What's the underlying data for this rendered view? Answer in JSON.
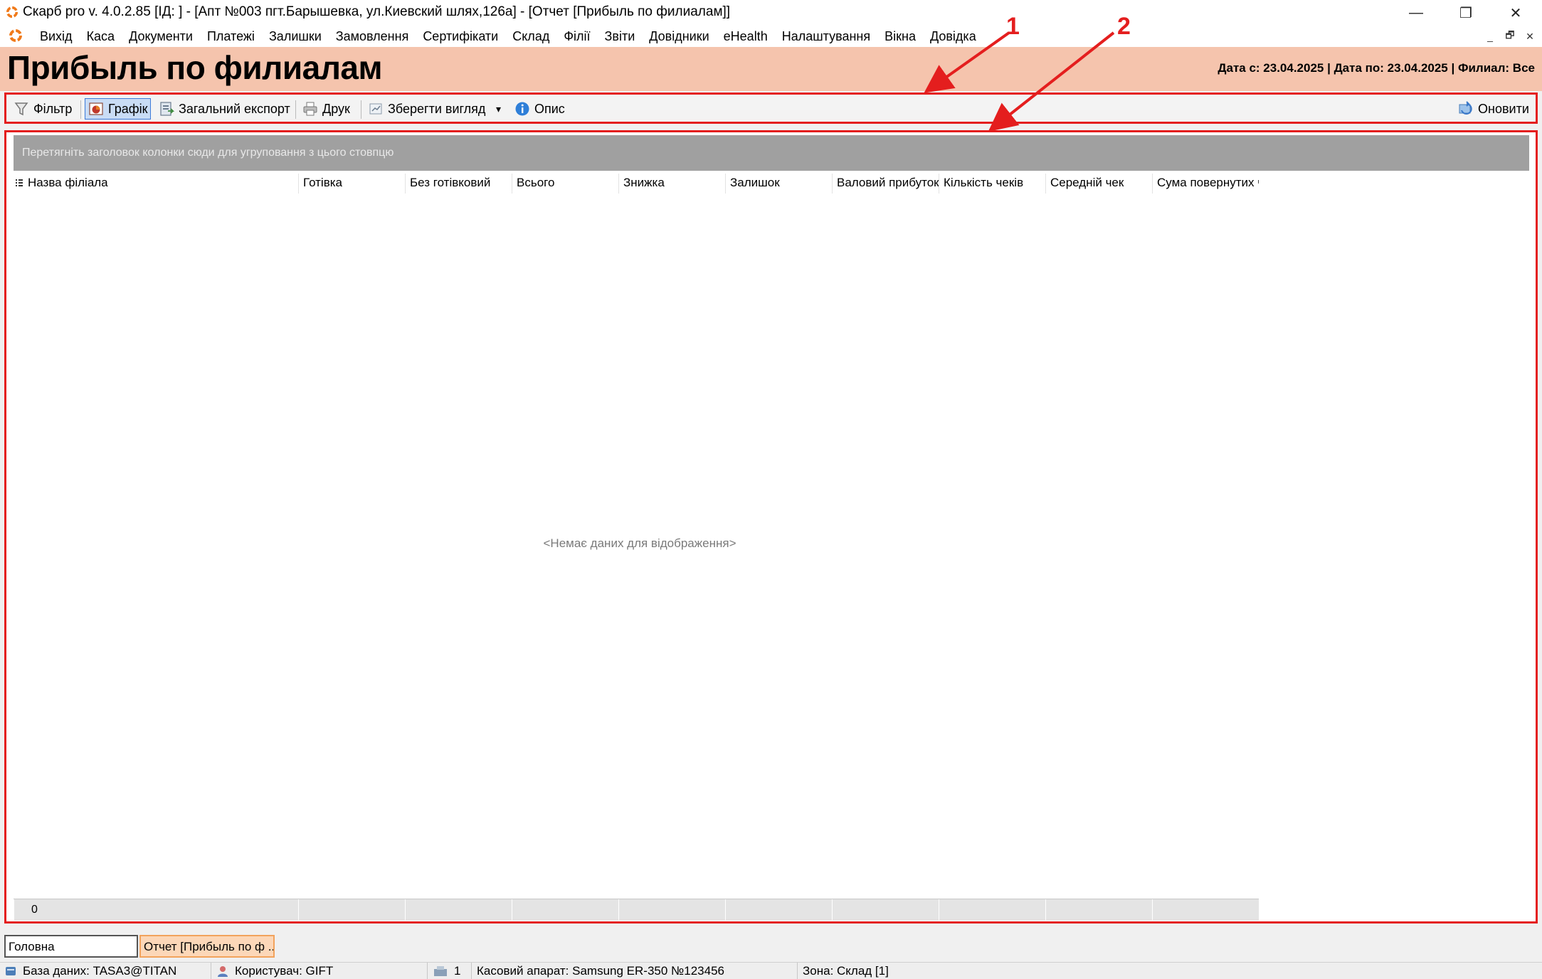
{
  "window": {
    "title": "Скарб pro v. 4.0.2.85 [ІД:       ] - [Апт №003 пгт.Барышевка, ул.Киевский шлях,126а] - [Отчет [Прибыль по филиалам]]",
    "minimize": "—",
    "restore": "❐",
    "close": "✕"
  },
  "menu": {
    "items": [
      "Вихід",
      "Каса",
      "Документи",
      "Платежі",
      "Залишки",
      "Замовлення",
      "Сертифікати",
      "Склад",
      "Філії",
      "Звіти",
      "Довідники",
      "eHealth",
      "Налаштування",
      "Вікна",
      "Довідка"
    ],
    "mdi_minimize": "_",
    "mdi_restore": "🗗",
    "mdi_close": "✕"
  },
  "header": {
    "title": "Прибыль по филиалам",
    "info": "Дата с: 23.04.2025 | Дата по: 23.04.2025 | Филиал: Все"
  },
  "toolbar": {
    "filter": "Фільтр",
    "chart": "Графік",
    "export": "Загальний експорт",
    "print": "Друк",
    "save_view": "Зберегти вигляд",
    "description": "Опис",
    "refresh": "Оновити",
    "dropdown": "▾"
  },
  "grid": {
    "group_hint": "Перетягніть заголовок колонки сюди для угруповання з цього стовпцю",
    "columns": [
      "Назва філіала",
      "Готівка",
      "Без готівковий",
      "Всього",
      "Знижка",
      "Залишок",
      "Валовий прибуток",
      "Кількість чеків",
      "Середній чек",
      "Сума повернутих ч"
    ],
    "empty_message": "<Немає даних для відображення>",
    "footer_first": "0"
  },
  "annotations": {
    "label_1": "1",
    "label_2": "2",
    "color": "#e41e1e"
  },
  "tabs": {
    "home": "Головна",
    "report": "Отчет [Прибыль по ф ..."
  },
  "status": {
    "db": "База даних: TASA3@TITAN",
    "user": "Користувач: GIFT",
    "count": "1",
    "register": "Касовий апарат: Samsung ER-350 №123456",
    "zone": "Зона: Склад [1]"
  }
}
